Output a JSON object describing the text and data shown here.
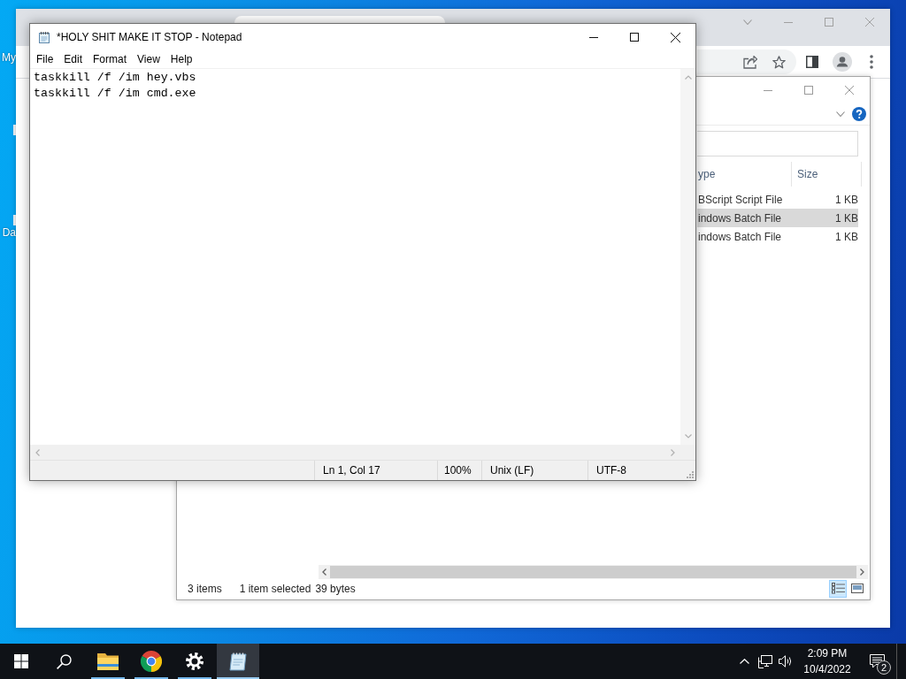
{
  "desktop": {
    "icons": [
      {
        "label": "My"
      },
      {
        "label": "Da"
      }
    ]
  },
  "notepad": {
    "title": "*HOLY SHIT MAKE IT STOP - Notepad",
    "menu": [
      "File",
      "Edit",
      "Format",
      "View",
      "Help"
    ],
    "lines": [
      "taskkill /f /im hey.vbs",
      "taskkill /f /im cmd.exe"
    ],
    "status_bar": [
      "Ln 1, Col 17",
      "100%",
      "Unix (LF)",
      "UTF-8"
    ]
  },
  "file_explorer": {
    "columns": [
      "ype",
      "Size"
    ],
    "rows": [
      {
        "type": "BScript Script File",
        "size": "1 KB",
        "selected": false
      },
      {
        "type": "indows Batch File",
        "size": "1 KB",
        "selected": true
      },
      {
        "type": "indows Batch File",
        "size": "1 KB",
        "selected": false
      }
    ],
    "status_bar": {
      "item_count": "3 items",
      "selection": "1 item selected",
      "selection_size": "39 bytes"
    },
    "view_buttons": [
      {
        "kind": "details",
        "selected": true
      },
      {
        "kind": "large-icons",
        "selected": false
      }
    ]
  },
  "taskbar": {
    "items": [
      {
        "kind": "start",
        "running": false,
        "active": false
      },
      {
        "kind": "search",
        "running": false,
        "active": false
      },
      {
        "kind": "folder",
        "running": true,
        "active": false
      },
      {
        "kind": "browser",
        "running": true,
        "active": false
      },
      {
        "kind": "settings",
        "running": true,
        "active": false
      },
      {
        "kind": "notepad",
        "running": true,
        "active": true
      }
    ],
    "clock": {
      "time": "2:09 PM",
      "date": "10/4/2022"
    },
    "notification_count": "2"
  }
}
